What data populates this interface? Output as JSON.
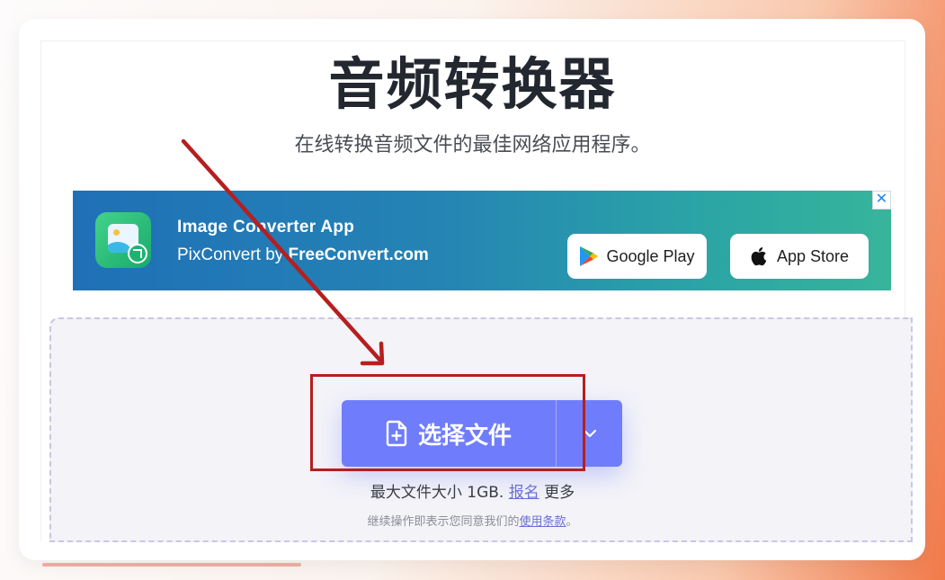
{
  "header": {
    "title": "音频转换器",
    "subtitle": "在线转换音频文件的最佳网络应用程序。"
  },
  "ad_banner": {
    "app_title": "Image Converter App",
    "app_sub_prefix": "PixConvert by ",
    "app_sub_brand": "FreeConvert.com",
    "google_play_label": "Google Play",
    "app_store_label": "App Store",
    "close_glyph": "✕",
    "gradient_start": "#1f70b7",
    "gradient_end": "#37b59b"
  },
  "upload": {
    "choose_button_label": "选择文件",
    "file_icon": "file-plus-icon",
    "dropdown_icon": "chevron-down-icon",
    "button_color": "#6f7dfc",
    "limit_text": "最大文件大小 1GB.",
    "signup_link": "报名",
    "more_text": "更多",
    "terms_prefix": "继续操作即表示您同意我们的",
    "terms_link": "使用条款",
    "terms_suffix": "。"
  },
  "annotation": {
    "arrow_color": "#b51f1f",
    "highlight_target": "choose-file-button"
  }
}
